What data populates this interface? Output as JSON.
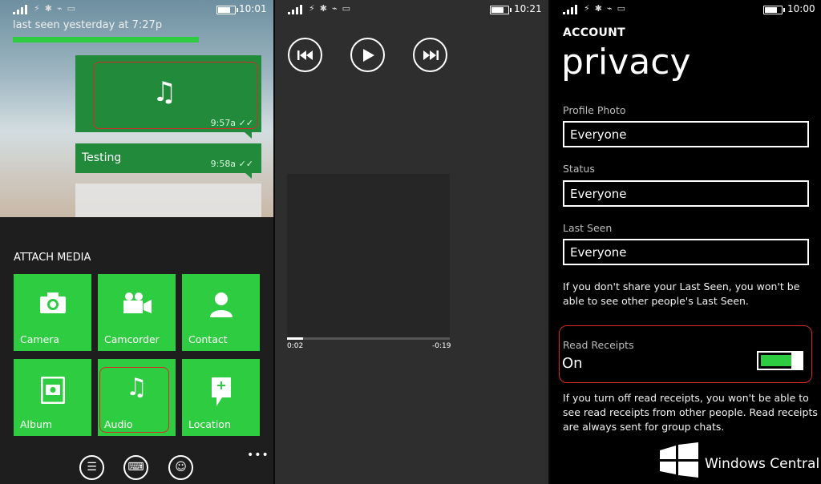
{
  "screens": {
    "chat": {
      "status_time": "10:01",
      "last_seen": "last seen yesterday at 7:27p",
      "messages": [
        {
          "time": "9:57a",
          "ticks": "✓✓",
          "icon": "music-note-icon"
        },
        {
          "text": "Testing",
          "time": "9:58a",
          "ticks": "✓✓"
        }
      ],
      "attach_title": "ATTACH MEDIA",
      "tiles": [
        {
          "label": "Camera",
          "icon": "camera-icon"
        },
        {
          "label": "Camcorder",
          "icon": "camcorder-icon"
        },
        {
          "label": "Contact",
          "icon": "contact-icon"
        },
        {
          "label": "Album",
          "icon": "album-icon"
        },
        {
          "label": "Audio",
          "icon": "music-note-icon"
        },
        {
          "label": "Location",
          "icon": "location-icon"
        }
      ],
      "appbar": [
        "emoji-list-icon",
        "keyboard-icon",
        "smiley-icon"
      ],
      "more": "•••"
    },
    "player": {
      "status_time": "10:21",
      "elapsed": "0:02",
      "remaining": "-0:19",
      "progress_fraction": 0.1
    },
    "privacy": {
      "status_time": "10:00",
      "section": "ACCOUNT",
      "title": "privacy",
      "fields": [
        {
          "label": "Profile Photo",
          "value": "Everyone"
        },
        {
          "label": "Status",
          "value": "Everyone"
        },
        {
          "label": "Last Seen",
          "value": "Everyone"
        }
      ],
      "last_seen_note": "If you don't share your Last Seen, you won't be able to see other people's Last Seen.",
      "read_receipts": {
        "label": "Read Receipts",
        "value": "On",
        "on": true
      },
      "read_receipts_note": "If you turn off read receipts, you won't be able to see read receipts from other people. Read receipts are always sent for group chats.",
      "watermark": "Windows Central"
    }
  },
  "colors": {
    "green": "#2ecc40",
    "bubble_green": "#228b3b",
    "highlight_red": "#d62b2b"
  }
}
